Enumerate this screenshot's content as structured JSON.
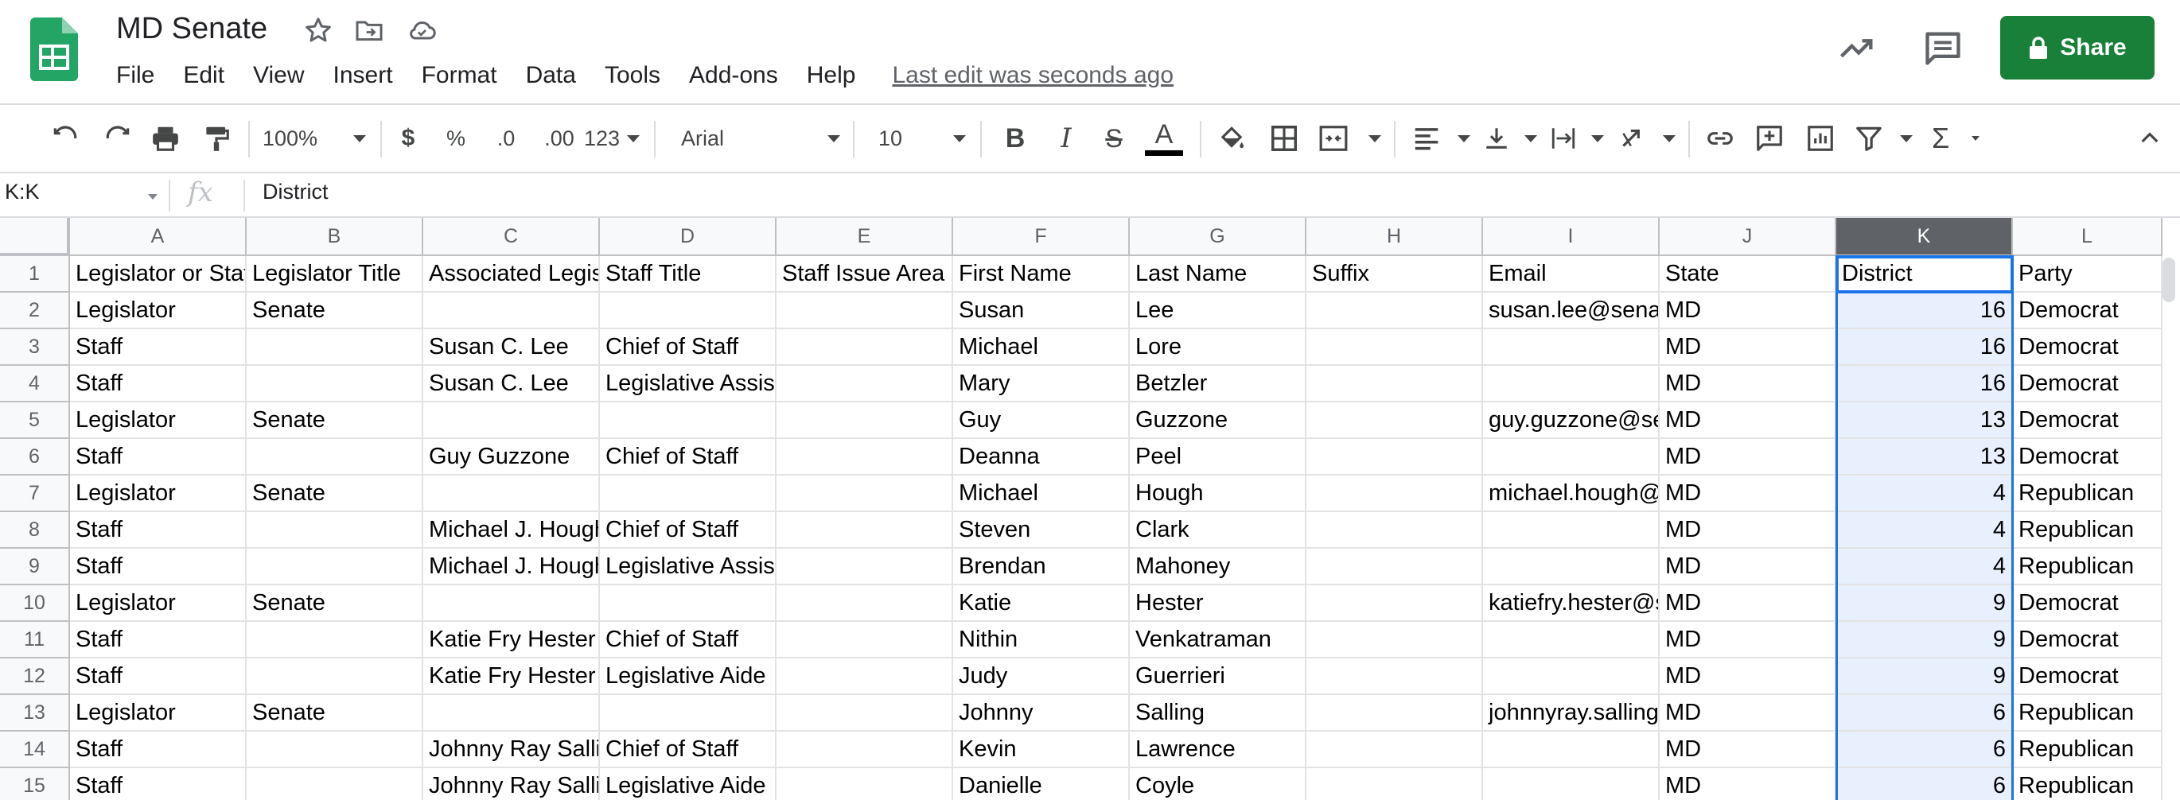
{
  "doc": {
    "title": "MD Senate",
    "menu": [
      "File",
      "Edit",
      "View",
      "Insert",
      "Format",
      "Data",
      "Tools",
      "Add-ons",
      "Help"
    ],
    "last_edit": "Last edit was seconds ago",
    "share_label": "Share",
    "brand_color": "#188038",
    "accent_color": "#1a73e8"
  },
  "toolbar": {
    "zoom": "100%",
    "currency": "$",
    "percent": "%",
    "dec_decrease": ".0",
    "dec_increase": ".00",
    "more_formats": "123",
    "font": "Arial",
    "font_size": "10",
    "bold": "B",
    "italic": "I",
    "strike": "S",
    "text_color_glyph": "A",
    "sum_glyph": "Σ"
  },
  "formula_bar": {
    "name_box": "K:K",
    "fx": "fx",
    "value": "District"
  },
  "sheet": {
    "columns": [
      "A",
      "B",
      "C",
      "D",
      "E",
      "F",
      "G",
      "H",
      "I",
      "J",
      "K",
      "L"
    ],
    "selected_column": "K",
    "rows": [
      {
        "n": "1",
        "cells": [
          "Legislator or Staff",
          "Legislator Title",
          "Associated Legislator",
          "Staff Title",
          "Staff Issue Area",
          "First Name",
          "Last Name",
          "Suffix",
          "Email",
          "State",
          "District",
          "Party"
        ]
      },
      {
        "n": "2",
        "cells": [
          "Legislator",
          "Senate",
          "",
          "",
          "",
          "Susan",
          "Lee",
          "",
          "susan.lee@senate",
          "MD",
          "16",
          "Democrat"
        ]
      },
      {
        "n": "3",
        "cells": [
          "Staff",
          "",
          "Susan C. Lee",
          "Chief of Staff",
          "",
          "Michael",
          "Lore",
          "",
          "",
          "MD",
          "16",
          "Democrat"
        ]
      },
      {
        "n": "4",
        "cells": [
          "Staff",
          "",
          "Susan C. Lee",
          "Legislative Assistant",
          "",
          "Mary",
          "Betzler",
          "",
          "",
          "MD",
          "16",
          "Democrat"
        ]
      },
      {
        "n": "5",
        "cells": [
          "Legislator",
          "Senate",
          "",
          "",
          "",
          "Guy",
          "Guzzone",
          "",
          "guy.guzzone@senate",
          "MD",
          "13",
          "Democrat"
        ]
      },
      {
        "n": "6",
        "cells": [
          "Staff",
          "",
          "Guy Guzzone",
          "Chief of Staff",
          "",
          "Deanna",
          "Peel",
          "",
          "",
          "MD",
          "13",
          "Democrat"
        ]
      },
      {
        "n": "7",
        "cells": [
          "Legislator",
          "Senate",
          "",
          "",
          "",
          "Michael",
          "Hough",
          "",
          "michael.hough@senate",
          "MD",
          "4",
          "Republican"
        ]
      },
      {
        "n": "8",
        "cells": [
          "Staff",
          "",
          "Michael J. Hough",
          "Chief of Staff",
          "",
          "Steven",
          "Clark",
          "",
          "",
          "MD",
          "4",
          "Republican"
        ]
      },
      {
        "n": "9",
        "cells": [
          "Staff",
          "",
          "Michael J. Hough",
          "Legislative Assistant",
          "",
          "Brendan",
          "Mahoney",
          "",
          "",
          "MD",
          "4",
          "Republican"
        ]
      },
      {
        "n": "10",
        "cells": [
          "Legislator",
          "Senate",
          "",
          "",
          "",
          "Katie",
          "Hester",
          "",
          "katiefry.hester@senate",
          "MD",
          "9",
          "Democrat"
        ]
      },
      {
        "n": "11",
        "cells": [
          "Staff",
          "",
          "Katie Fry Hester",
          "Chief of Staff",
          "",
          "Nithin",
          "Venkatraman",
          "",
          "",
          "MD",
          "9",
          "Democrat"
        ]
      },
      {
        "n": "12",
        "cells": [
          "Staff",
          "",
          "Katie Fry Hester",
          "Legislative Aide",
          "",
          "Judy",
          "Guerrieri",
          "",
          "",
          "MD",
          "9",
          "Democrat"
        ]
      },
      {
        "n": "13",
        "cells": [
          "Legislator",
          "Senate",
          "",
          "",
          "",
          "Johnny",
          "Salling",
          "",
          "johnnyray.salling@senate",
          "MD",
          "6",
          "Republican"
        ]
      },
      {
        "n": "14",
        "cells": [
          "Staff",
          "",
          "Johnny Ray Salling",
          "Chief of Staff",
          "",
          "Kevin",
          "Lawrence",
          "",
          "",
          "MD",
          "6",
          "Republican"
        ]
      },
      {
        "n": "15",
        "cells": [
          "Staff",
          "",
          "Johnny Ray Salling",
          "Legislative Aide",
          "",
          "Danielle",
          "Coyle",
          "",
          "",
          "MD",
          "6",
          "Republican"
        ]
      }
    ]
  }
}
